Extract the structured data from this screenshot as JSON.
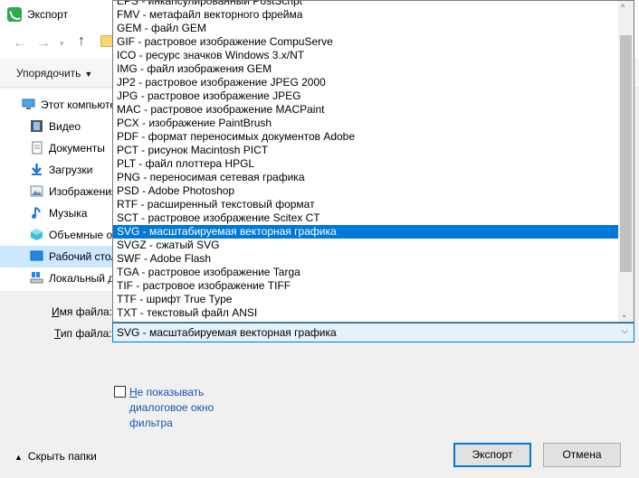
{
  "window": {
    "title": "Экспорт",
    "close": "✕"
  },
  "toolbar": {
    "organize_label": "Упорядочить"
  },
  "sidebar": {
    "items": [
      {
        "label": "Этот компьютер",
        "icon": "computer-icon"
      },
      {
        "label": "Видео",
        "icon": "video-icon"
      },
      {
        "label": "Документы",
        "icon": "documents-icon"
      },
      {
        "label": "Загрузки",
        "icon": "downloads-icon"
      },
      {
        "label": "Изображения",
        "icon": "pictures-icon"
      },
      {
        "label": "Музыка",
        "icon": "music-icon"
      },
      {
        "label": "Объемные объекты",
        "icon": "3d-objects-icon"
      },
      {
        "label": "Рабочий стол",
        "icon": "desktop-icon"
      },
      {
        "label": "Локальный диск",
        "icon": "local-disk-icon"
      }
    ]
  },
  "form": {
    "filename_label_prefix": "",
    "filename_label_underlined": "И",
    "filename_label_rest": "мя файла:",
    "filetype_label_prefix": "",
    "filetype_label_underlined": "Т",
    "filetype_label_rest": "ип файла:",
    "filetype_value": "SVG - масштабируемая векторная графика"
  },
  "dropdown": {
    "options": [
      "EPS - инкапсулированный PostScript",
      "FMV - метафайл векторного фрейма",
      "GEM - файл GEM",
      "GIF - растровое изображение CompuServe",
      "ICO - ресурс значков Windows 3.x/NT",
      "IMG - файл изображения GEM",
      "JP2 - растровое изображение JPEG 2000",
      "JPG - растровое изображение JPEG",
      "MAC - растровое изображение MACPaint",
      "PCX - изображение PaintBrush",
      "PDF - формат переносимых документов Adobe",
      "PCT - рисунок Macintosh PICT",
      "PLT - файл плоттера HPGL",
      "PNG - переносимая сетевая графика",
      "PSD - Adobe Photoshop",
      "RTF - расширенный текстовый формат",
      "SCT - растровое изображение Scitex CT",
      "SVG - масштабируемая векторная графика",
      "SVGZ - сжатый SVG",
      "SWF - Adobe Flash",
      "TGA - растровое изображение Targa",
      "TIF - растровое изображение TIFF",
      "TTF - шрифт True Type",
      "TXT - текстовый файл ANSI"
    ],
    "selected_index": 17
  },
  "filter_checkbox": {
    "underlined": "Н",
    "label_rest": "е показывать диалоговое окно фильтра",
    "checked": false
  },
  "hide_folders_label": "Скрыть папки",
  "buttons": {
    "export": "Экспорт",
    "cancel": "Отмена"
  },
  "colors": {
    "selection": "#0078d7",
    "sidebar_selected": "#cce8ff",
    "link": "#1a55b0"
  }
}
